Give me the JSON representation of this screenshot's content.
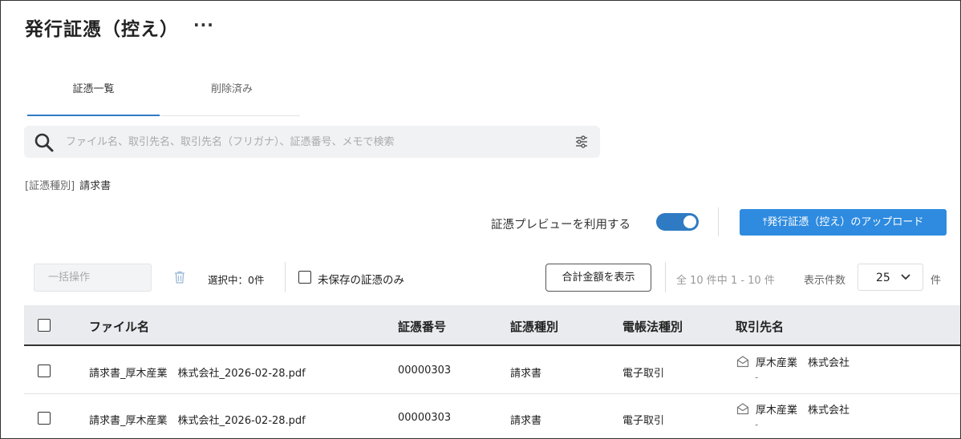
{
  "header": {
    "title": "発行証憑（控え）",
    "more_label": "···"
  },
  "tabs": [
    {
      "label": "証憑一覧",
      "active": true
    },
    {
      "label": "削除済み",
      "active": false
    }
  ],
  "search": {
    "placeholder": "ファイル名、取引先名、取引先名（フリガナ）、証憑番号、メモで検索",
    "value": ""
  },
  "filter": {
    "key": "[証憑種別]",
    "value": "請求書"
  },
  "preview": {
    "label": "証憑プレビューを利用する",
    "enabled": true
  },
  "upload_button": {
    "label": "⤒発行証憑（控え）のアップロード"
  },
  "toolbar": {
    "bulk_label": "一括操作",
    "selected_text": "選択中：0件",
    "unsaved_only_label": "未保存の証憑のみ",
    "unsaved_only_checked": false,
    "total_button_label": "合計金額を表示",
    "range_text": "全 10 件中 1 - 10 件",
    "per_page_label": "表示件数",
    "per_page_value": "25",
    "per_page_unit": "件"
  },
  "table": {
    "columns": [
      "ファイル名",
      "証憑番号",
      "証憑種別",
      "電帳法種別",
      "取引先名"
    ],
    "rows": [
      {
        "file": "請求書_厚木産業　株式会社_2026-02-28.pdf",
        "number": "00000303",
        "type": "請求書",
        "law_type": "電子取引",
        "partner": "厚木産業　株式会社",
        "partner_sub": "-"
      },
      {
        "file": "請求書_厚木産業　株式会社_2026-02-28.pdf",
        "number": "00000303",
        "type": "請求書",
        "law_type": "電子取引",
        "partner": "厚木産業　株式会社",
        "partner_sub": "-"
      }
    ]
  },
  "colors": {
    "accent": "#2e7bc4",
    "upload_button": "#2e8be0",
    "header_bg": "#e9ebee"
  }
}
